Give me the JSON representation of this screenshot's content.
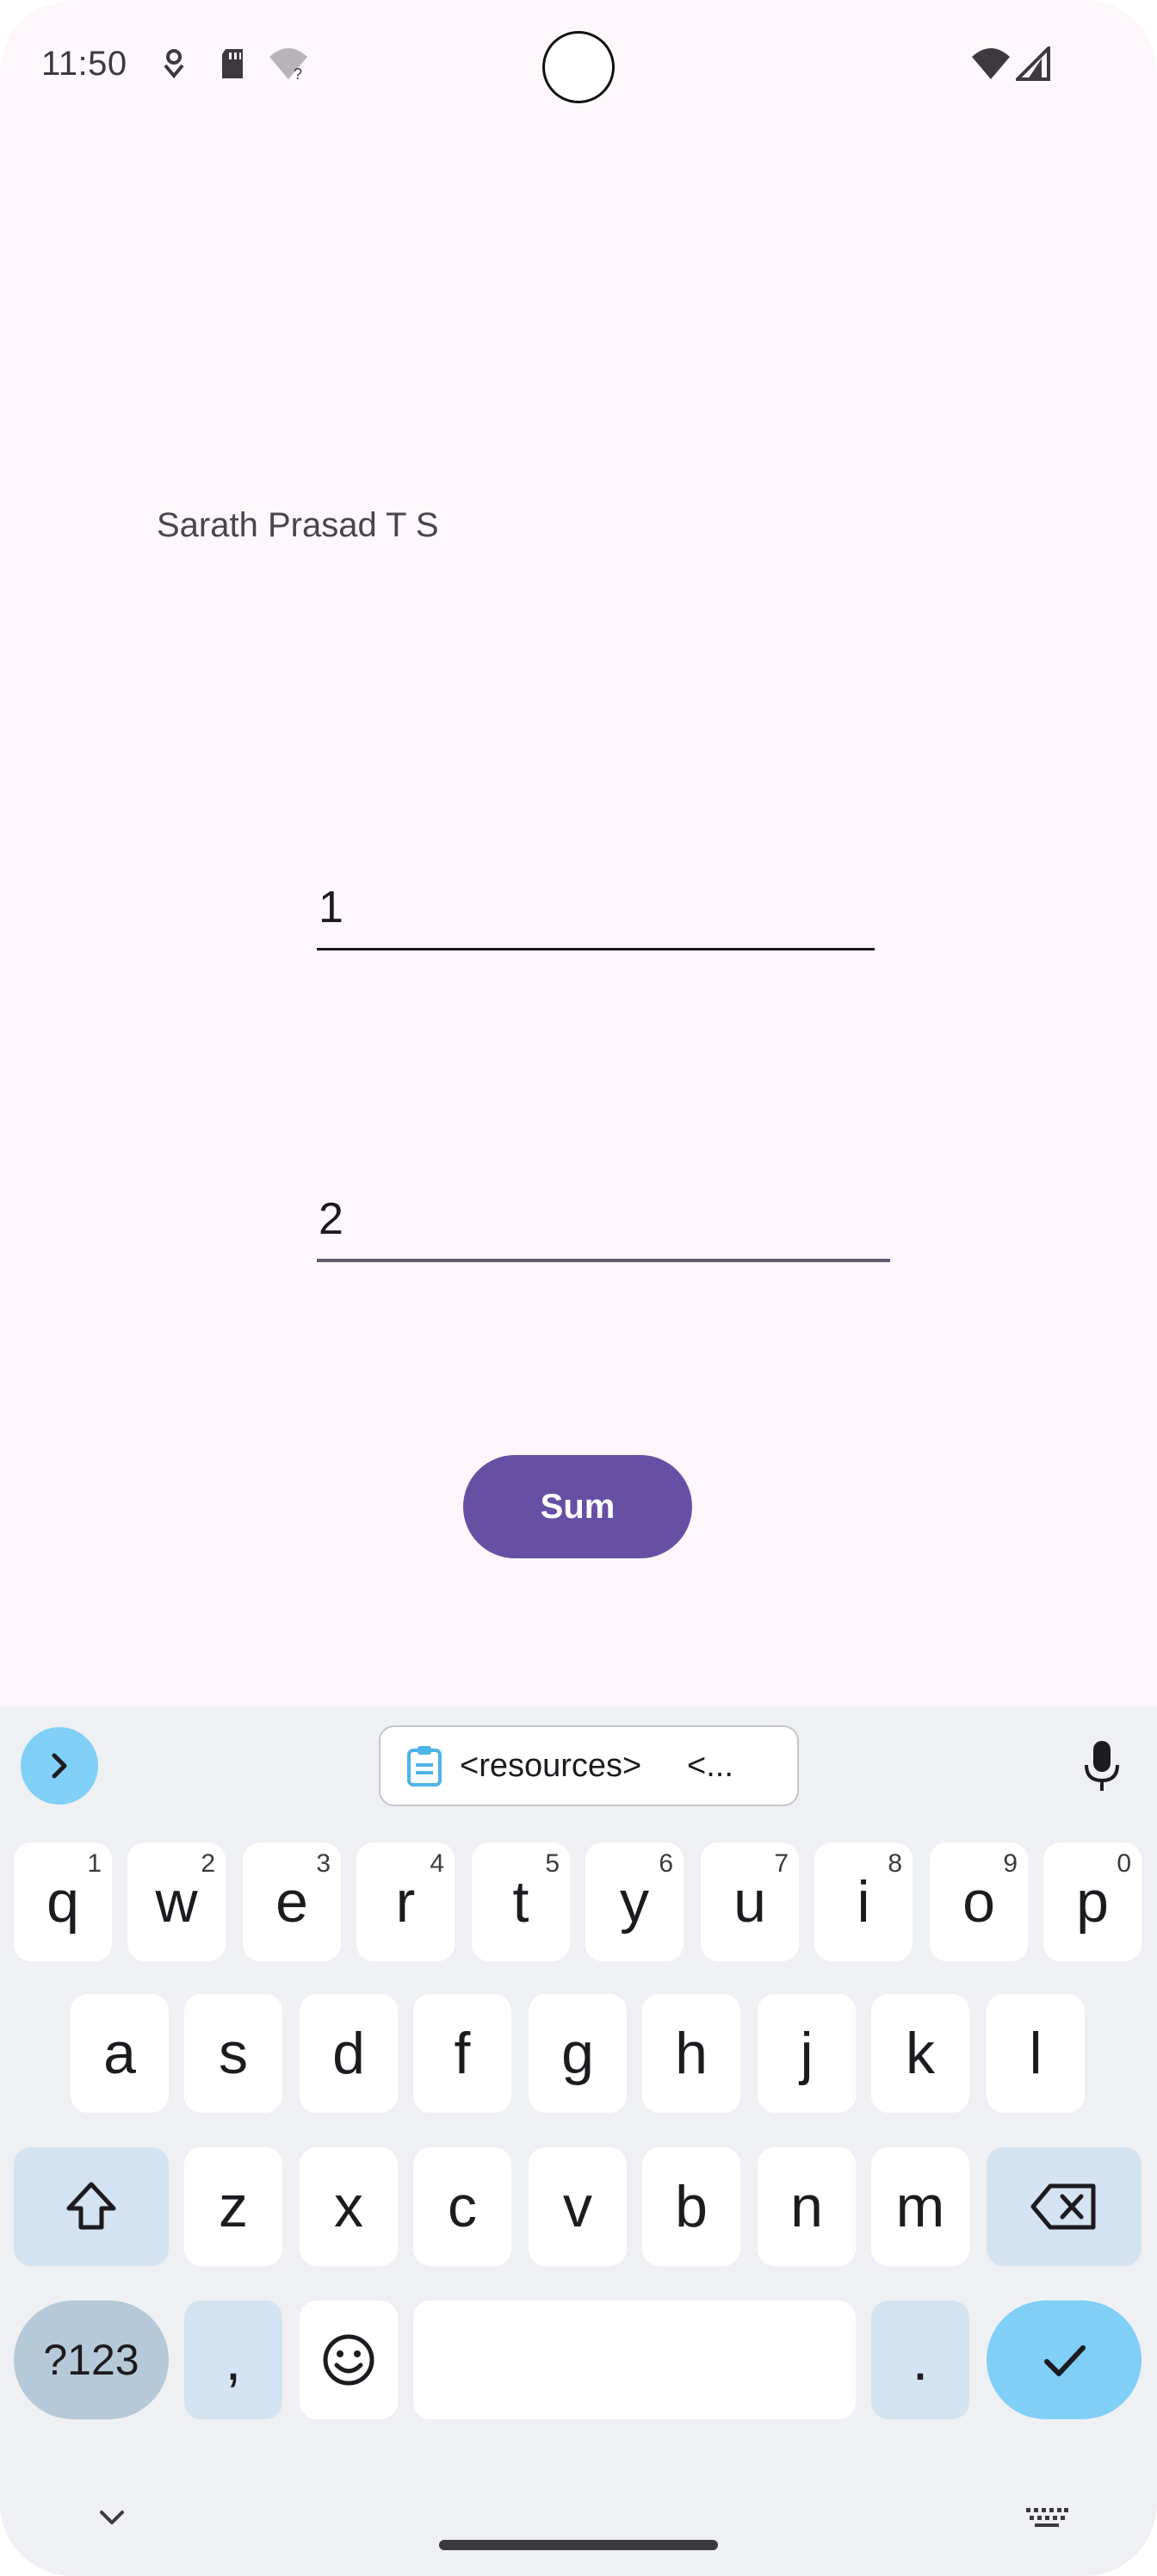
{
  "status_bar": {
    "time": "11:50"
  },
  "main": {
    "name_label": "Sarath Prasad T S",
    "input1_value": "1",
    "input2_value": "2",
    "sum_button_label": "Sum"
  },
  "keyboard": {
    "clipboard_chip": "<resources>     <...",
    "row1": [
      {
        "label": "q",
        "hint": "1"
      },
      {
        "label": "w",
        "hint": "2"
      },
      {
        "label": "e",
        "hint": "3"
      },
      {
        "label": "r",
        "hint": "4"
      },
      {
        "label": "t",
        "hint": "5"
      },
      {
        "label": "y",
        "hint": "6"
      },
      {
        "label": "u",
        "hint": "7"
      },
      {
        "label": "i",
        "hint": "8"
      },
      {
        "label": "o",
        "hint": "9"
      },
      {
        "label": "p",
        "hint": "0"
      }
    ],
    "row2": [
      "a",
      "s",
      "d",
      "f",
      "g",
      "h",
      "j",
      "k",
      "l"
    ],
    "row3": [
      "z",
      "x",
      "c",
      "v",
      "b",
      "n",
      "m"
    ],
    "symbols_label": "?123",
    "comma_label": ",",
    "period_label": "."
  },
  "colors": {
    "accent": "#6750a4",
    "background": "#fdf7fc",
    "keyboard_accent": "#7fcff7"
  },
  "icons": [
    "data-saver-icon",
    "sd-card-icon",
    "wifi-unknown-icon",
    "wifi-icon",
    "cellular-signal-icon",
    "chevron-right-icon",
    "clipboard-icon",
    "microphone-icon",
    "shift-icon",
    "backspace-icon",
    "emoji-icon",
    "check-icon",
    "chevron-down-icon",
    "keyboard-icon"
  ]
}
